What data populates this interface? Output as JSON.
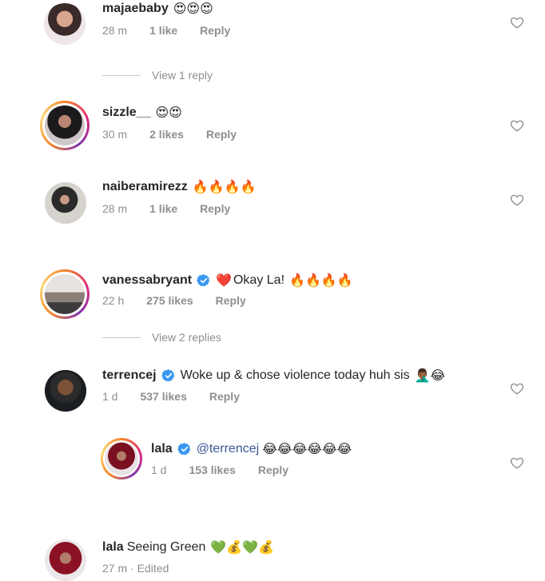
{
  "comments": [
    {
      "username": "majaebaby",
      "emoji": "😍😍😍",
      "time": "28 m",
      "likes": "1 like",
      "reply": "Reply",
      "view_replies": "View 1 reply"
    },
    {
      "username": "sizzle__",
      "emoji": "😍😍",
      "time": "30 m",
      "likes": "2 likes",
      "reply": "Reply"
    },
    {
      "username": "naiberamirezz",
      "emoji": "🔥🔥🔥🔥",
      "time": "28 m",
      "likes": "1 like",
      "reply": "Reply"
    },
    {
      "username": "vanessabryant",
      "heart_emoji": "❤️",
      "text": "Okay La!",
      "emoji": "🔥🔥🔥🔥",
      "time": "22 h",
      "likes": "275 likes",
      "reply": "Reply",
      "view_replies": "View 2 replies"
    },
    {
      "username": "terrencej",
      "text": "Woke up & chose violence today huh sis",
      "emoji": "🤦🏾‍♂️😂",
      "time": "1 d",
      "likes": "537 likes",
      "reply": "Reply"
    },
    {
      "username": "lala",
      "mention": "@terrencej",
      "emoji": "😂😂😂😂😂😂",
      "time": "1 d",
      "likes": "153 likes",
      "reply": "Reply"
    },
    {
      "username": "lala",
      "text": "Seeing Green",
      "emoji": "💚💰💚💰",
      "time": "27 m",
      "edited": "· Edited"
    }
  ],
  "colors": {
    "text": "#262626",
    "meta": "#8e8e8e",
    "verified": "#3897f0",
    "mention": "#385898"
  },
  "icons": [
    "heart-outline-icon",
    "verified-badge-icon"
  ]
}
